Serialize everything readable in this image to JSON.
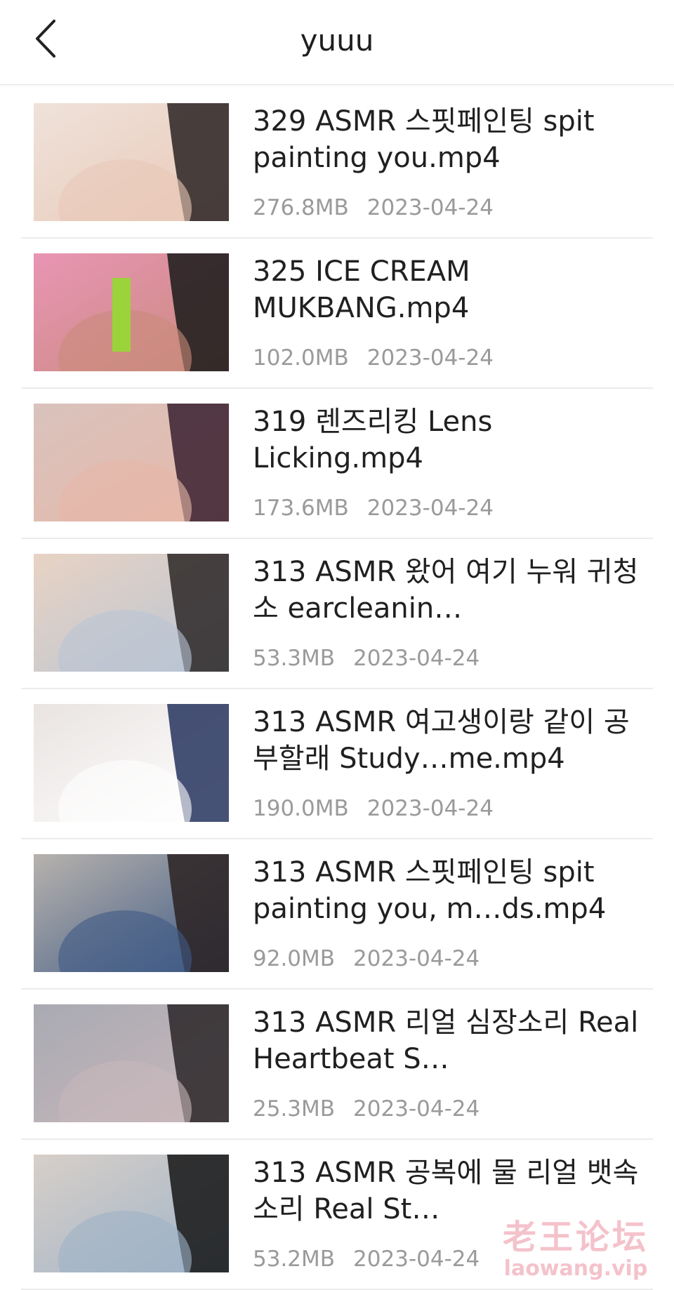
{
  "header": {
    "title": "yuuu",
    "back_icon": "chevron-left-icon"
  },
  "files": [
    {
      "name": "329 ASMR 스핏페인팅 spit painting you.mp4",
      "size": "276.8MB",
      "date": "2023-04-24",
      "thumb_colors": [
        "#efe2da",
        "#e9c8b8",
        "#2a2323"
      ]
    },
    {
      "name": "325 ICE CREAM MUKBANG.mp4",
      "size": "102.0MB",
      "date": "2023-04-24",
      "thumb_colors": [
        "#e895b4",
        "#c98a7c",
        "#1a1a1a",
        "#9bd33a"
      ]
    },
    {
      "name": "319 렌즈리킹 Lens Licking.mp4",
      "size": "173.6MB",
      "date": "2023-04-24",
      "thumb_colors": [
        "#d9c3bd",
        "#e6b7a9",
        "#3a2030"
      ]
    },
    {
      "name": "313 ASMR 왔어 여기 누워 귀청소 earcleanin…",
      "size": "53.3MB",
      "date": "2023-04-24",
      "thumb_colors": [
        "#e8d3c4",
        "#b9c4d3",
        "#2b2626"
      ]
    },
    {
      "name": "313 ASMR 여고생이랑 같이 공부할래 Study…me.mp4",
      "size": "190.0MB",
      "date": "2023-04-24",
      "thumb_colors": [
        "#e9e4e2",
        "#ffffff",
        "#26335e"
      ]
    },
    {
      "name": "313 ASMR 스핏페인팅  spit painting you, m…ds.mp4",
      "size": "92.0MB",
      "date": "2023-04-24",
      "thumb_colors": [
        "#b7b2ad",
        "#3f5a85",
        "#2b2222"
      ]
    },
    {
      "name": "313 ASMR 리얼 심장소리 Real Heartbeat S…",
      "size": "25.3MB",
      "date": "2023-04-24",
      "thumb_colors": [
        "#a9aab2",
        "#c8b8bb",
        "#2a2628"
      ]
    },
    {
      "name": "313 ASMR 공복에 물  리얼 뱃속 소리  Real St…",
      "size": "53.2MB",
      "date": "2023-04-24",
      "thumb_colors": [
        "#d7cfc9",
        "#9fb3c7",
        "#151515"
      ]
    }
  ],
  "watermark": {
    "cn": "老王论坛",
    "url": "laowang.vip"
  }
}
